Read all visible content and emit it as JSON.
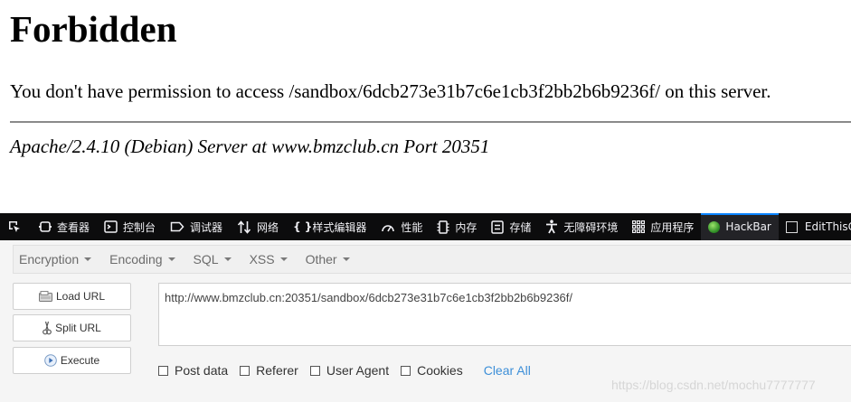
{
  "error_page": {
    "title": "Forbidden",
    "message": "You don't have permission to access /sandbox/6dcb273e31b7c6e1cb3f2bb2b6b9236f/ on this server.",
    "server_address": "Apache/2.4.10 (Debian) Server at www.bmzclub.cn Port 20351"
  },
  "devtools": {
    "tabs": [
      {
        "label": "查看器",
        "icon": "inspector-icon"
      },
      {
        "label": "控制台",
        "icon": "console-icon"
      },
      {
        "label": "调试器",
        "icon": "debugger-icon"
      },
      {
        "label": "网络",
        "icon": "network-icon"
      },
      {
        "label": "样式编辑器",
        "icon": "style-editor-icon"
      },
      {
        "label": "性能",
        "icon": "performance-icon"
      },
      {
        "label": "内存",
        "icon": "memory-icon"
      },
      {
        "label": "存储",
        "icon": "storage-icon"
      },
      {
        "label": "无障碍环境",
        "icon": "accessibility-icon"
      },
      {
        "label": "应用程序",
        "icon": "application-icon"
      },
      {
        "label": "HackBar",
        "icon": "hackbar-icon"
      },
      {
        "label": "EditThisC",
        "icon": "editthiscookie-icon"
      }
    ],
    "selected_tab": "HackBar",
    "accent_color": "#0a84ff",
    "background_color": "#0c0c0d"
  },
  "hackbar": {
    "menu": [
      "Encryption",
      "Encoding",
      "SQL",
      "XSS",
      "Other"
    ],
    "buttons": {
      "load_url": "Load URL",
      "split_url": "Split URL",
      "execute": "Execute"
    },
    "url_value": "http://www.bmzclub.cn:20351/sandbox/6dcb273e31b7c6e1cb3f2bb2b6b9236f/",
    "options": [
      "Post data",
      "Referer",
      "User Agent",
      "Cookies"
    ],
    "clear_all": "Clear All",
    "link_color": "#3d8fd8"
  },
  "watermark": "https://blog.csdn.net/mochu7777777"
}
